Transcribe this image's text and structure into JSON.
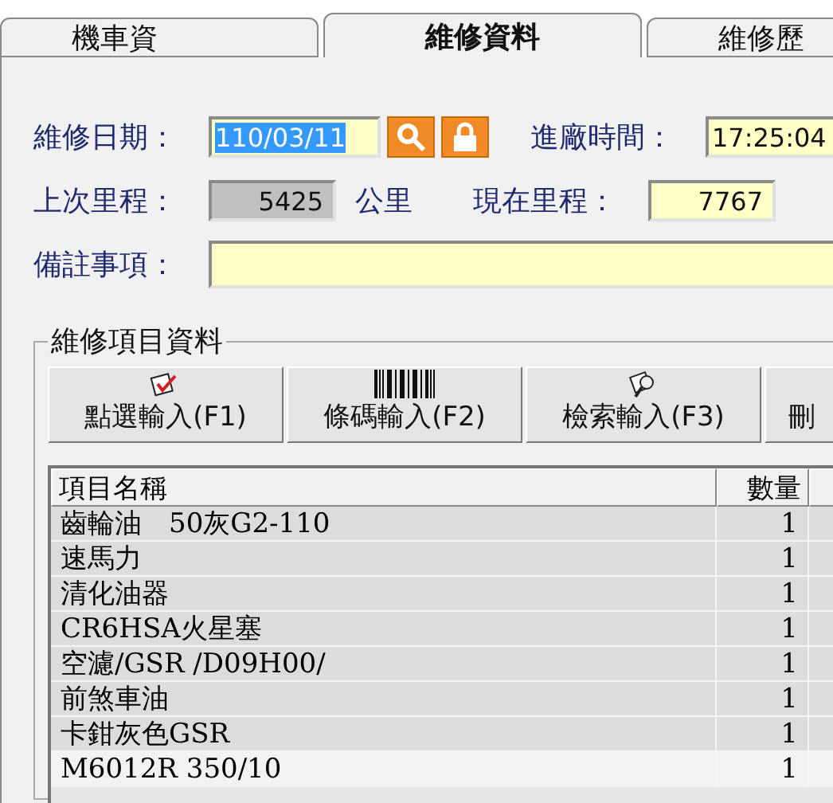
{
  "tabs": [
    {
      "label": "機車資",
      "selected": false
    },
    {
      "label": "維修資料",
      "selected": true
    },
    {
      "label": "維修歷",
      "selected": false
    }
  ],
  "form": {
    "date_label": "維修日期：",
    "date_value": "110/03/11",
    "date_highlighted": true,
    "entry_time_label": "進廠時間：",
    "entry_time_value": "17:25:04",
    "last_mileage_label": "上次里程：",
    "last_mileage_value": "5425",
    "mileage_unit": "公里",
    "current_mileage_label": "現在里程：",
    "current_mileage_value": "7767",
    "notes_label": "備註事項："
  },
  "items_group": {
    "title": "維修項目資料",
    "buttons": [
      {
        "kind": "check",
        "label": "點選輸入(F1)"
      },
      {
        "kind": "barcode",
        "label": "條碼輸入(F2)"
      },
      {
        "kind": "search",
        "label": "檢索輸入(F3)"
      },
      {
        "kind": "plain",
        "label": "刪"
      }
    ],
    "table": {
      "columns": [
        "項目名稱",
        "數量"
      ],
      "rows": [
        {
          "name": "齒輪油　50灰G2-110",
          "qty": "1",
          "selected": false
        },
        {
          "name": "速馬力",
          "qty": "1",
          "selected": false
        },
        {
          "name": "清化油器",
          "qty": "1",
          "selected": false
        },
        {
          "name": "CR6HSA火星塞",
          "qty": "1",
          "selected": false
        },
        {
          "name": "空濾/GSR /D09H00/",
          "qty": "1",
          "selected": false
        },
        {
          "name": "前煞車油",
          "qty": "1",
          "selected": false
        },
        {
          "name": "卡鉗灰色GSR",
          "qty": "1",
          "selected": false
        },
        {
          "name": "M6012R 350/10",
          "qty": "1",
          "selected": true
        }
      ]
    }
  }
}
